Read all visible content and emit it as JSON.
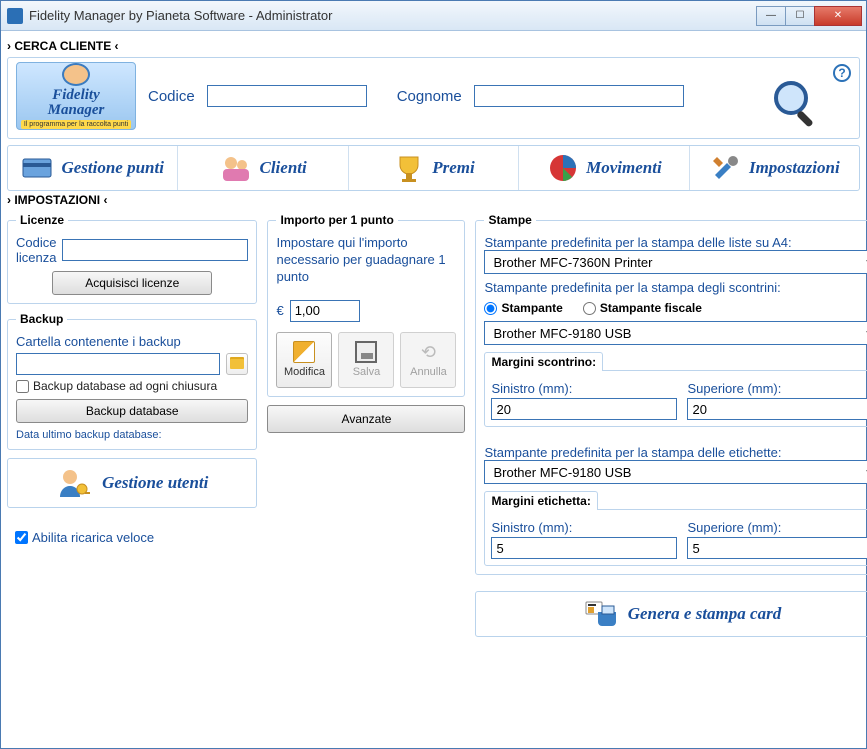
{
  "window": {
    "title": "Fidelity Manager by Pianeta Software - Administrator"
  },
  "logo": {
    "line1": "Fidelity",
    "line2": "Manager",
    "subtitle": "Il programma per la raccolta punti"
  },
  "search": {
    "group_title": "› CERCA CLIENTE ‹",
    "codice_label": "Codice",
    "cognome_label": "Cognome",
    "codice_value": "",
    "cognome_value": ""
  },
  "tabs": {
    "gestione_punti": "Gestione punti",
    "clienti": "Clienti",
    "premi": "Premi",
    "movimenti": "Movimenti",
    "impostazioni": "Impostazioni"
  },
  "settings_title": "› IMPOSTAZIONI ‹",
  "licenze": {
    "legend": "Licenze",
    "codice_label": "Codice licenza",
    "codice_value": "",
    "acquisisci_btn": "Acquisisci licenze"
  },
  "backup": {
    "legend": "Backup",
    "folder_label": "Cartella contenente i backup",
    "folder_value": "",
    "on_close_label": "Backup database ad ogni chiusura",
    "backup_btn": "Backup database",
    "last_backup_label": "Data ultimo backup database:"
  },
  "user_mgmt": {
    "label": "Gestione utenti"
  },
  "fast_reload": {
    "label": "Abilita ricarica veloce"
  },
  "importo": {
    "legend": "Importo per 1 punto",
    "description": "Impostare qui l'importo necessario per guadagnare 1 punto",
    "currency": "€",
    "value": "1,00",
    "modifica": "Modifica",
    "salva": "Salva",
    "annulla": "Annulla",
    "avanzate": "Avanzate"
  },
  "stampe": {
    "legend": "Stampe",
    "a4_label": "Stampante predefinita per la stampa delle liste su A4:",
    "a4_printer": "Brother MFC-7360N Printer",
    "scontrini_label": "Stampante predefinita per la stampa degli scontrini:",
    "radio_stampante": "Stampante",
    "radio_fiscale": "Stampante fiscale",
    "scontrini_printer": "Brother MFC-9180 USB",
    "margini_scontrino_legend": "Margini scontrino:",
    "sinistro_label": "Sinistro (mm):",
    "superiore_label": "Superiore (mm):",
    "scontrino_sinistro": "20",
    "scontrino_superiore": "20",
    "etichette_label": "Stampante predefinita per la stampa delle etichette:",
    "etichette_printer": "Brother MFC-9180 USB",
    "margini_etichetta_legend": "Margini etichetta:",
    "etichetta_sinistro": "5",
    "etichetta_superiore": "5"
  },
  "gen_card": {
    "label": "Genera e stampa card"
  }
}
